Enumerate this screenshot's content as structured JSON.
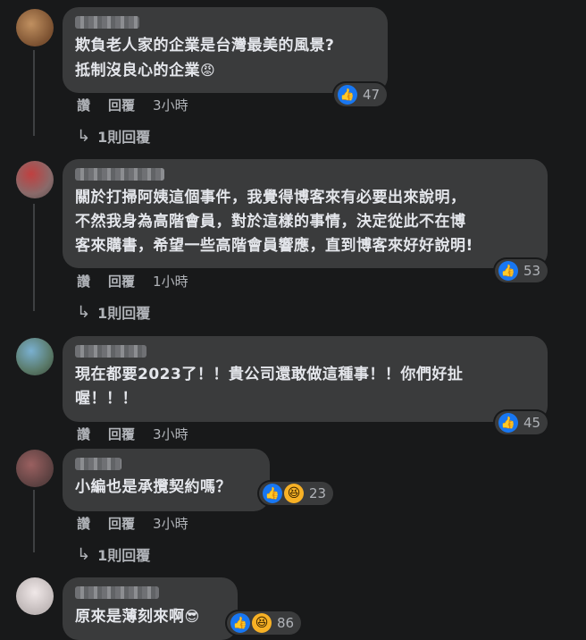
{
  "comments": [
    {
      "text": "欺負老人家的企業是台灣最美的風景?\n抵制沒良心的企業",
      "text_emoji": "😡",
      "reaction_count": "47",
      "like_label": "讚",
      "reply_label": "回覆",
      "time": "3小時",
      "replies_label": "1則回覆",
      "avatar_color": "#8a6a4a"
    },
    {
      "text": "關於打掃阿姨這個事件，我覺得博客來有必要出來說明，\n不然我身為高階會員，對於這樣的事情，決定從此不在博\n客來購書，希望一些高階會員響應，直到博客來好好說明!",
      "reaction_count": "53",
      "like_label": "讚",
      "reply_label": "回覆",
      "time": "1小時",
      "replies_label": "1則回覆",
      "avatar_color": "#a44a4a"
    },
    {
      "text": "現在都要2023了！！貴公司還敢做這種事！！你們好扯\n喔！！！",
      "reaction_count": "45",
      "like_label": "讚",
      "reply_label": "回覆",
      "time": "3小時",
      "avatar_color": "#6a8a9a"
    },
    {
      "text": "小編也是承攬契約嗎？",
      "reaction_count": "23",
      "like_label": "讚",
      "reply_label": "回覆",
      "time": "3小時",
      "replies_label": "1則回覆",
      "avatar_color": "#8a5a5a"
    },
    {
      "text": "原來是薄刻來啊",
      "text_emoji": "😎",
      "reaction_count": "86",
      "avatar_color": "#d8d0d0"
    }
  ],
  "icons": {
    "like": "thumbs-up-icon",
    "haha": "laughing-face-icon",
    "reply_arrow": "reply-arrow-icon"
  },
  "colors": {
    "background": "#18191a",
    "bubble": "#3a3b3c",
    "like_blue": "#1877f2"
  }
}
